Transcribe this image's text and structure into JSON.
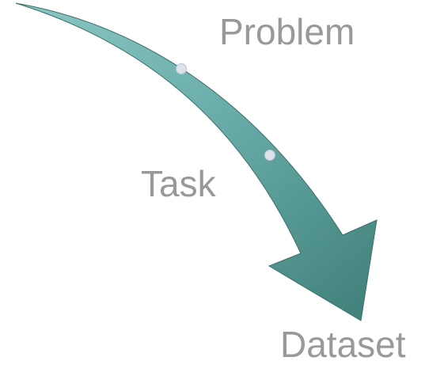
{
  "diagram": {
    "labels": {
      "problem": "Problem",
      "task": "Task",
      "dataset": "Dataset"
    },
    "icons": [
      "curved-arrow-icon",
      "waypoint-dot-icon"
    ],
    "colors": {
      "arrow_light": "#74b8b5",
      "arrow_dark": "#3f7f79",
      "arrow_stroke": "#3d6f6b",
      "dot_fill": "#dde2ec",
      "text": "#999999"
    }
  }
}
